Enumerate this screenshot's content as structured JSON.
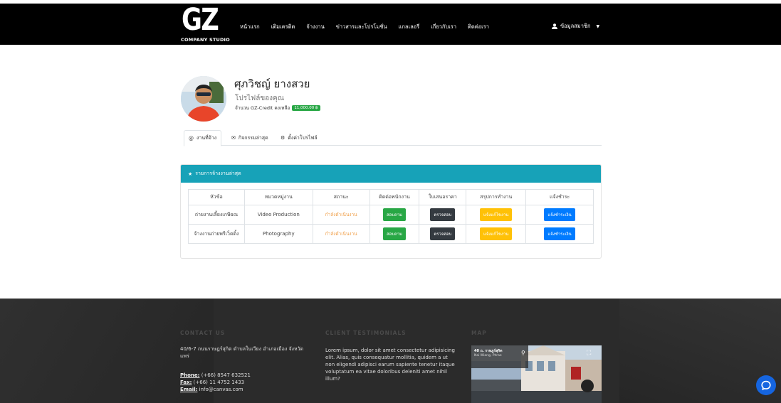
{
  "header": {
    "logo_text": "GZ",
    "logo_sub": "COMPANY STUDIO",
    "nav": [
      "หน้าแรก",
      "เติมเครดิต",
      "จ้างงาน",
      "ข่าวสารและโปรโมชั่น",
      "แกลเลอรี่",
      "เกี่ยวกับเรา",
      "ติดต่อเรา"
    ],
    "member_label": "ข้อมูลสมาชิก"
  },
  "profile": {
    "name": "ศุภวิชญ์ ยางสวย",
    "subtitle": "โปรไฟล์ของคุณ",
    "credit_label": "จำนวน GZ-Credit คงเหลือ",
    "credit_value": "11,000.00 ฿"
  },
  "tabs": [
    {
      "label": "งานที่จ้าง",
      "icon": "at-icon"
    },
    {
      "label": "กิจกรรมล่าสุด",
      "icon": "envelope-icon"
    },
    {
      "label": "ตั้งค่าโปรไฟล์",
      "icon": "gears-icon"
    }
  ],
  "card": {
    "title": "รายการจ้างงานล่าสุด",
    "columns": [
      "หัวข้อ",
      "หมวดหมู่งาน",
      "สถานะ",
      "ติดต่อพนักงาน",
      "ใบเสนอราคา",
      "สรุปการทำงาน",
      "แจ้งชำระ"
    ],
    "rows": [
      {
        "topic": "ถ่ายงานเลี้ยงเกษียณ",
        "category": "Video Production",
        "status": "กำลังดำเนินงาน",
        "contact": "สอบถาม",
        "quote": "ตรวจสอบ",
        "summary": "แจ้งแก้ไขงาน",
        "pay": "แจ้งชำระเงิน"
      },
      {
        "topic": "จ้างงานถ่ายพรีเว็ดดิ้ง",
        "category": "Photography",
        "status": "กำลังดำเนินงาน",
        "contact": "สอบถาม",
        "quote": "ตรวจสอบ",
        "summary": "แจ้งแก้ไขงาน",
        "pay": "แจ้งชำระเงิน"
      }
    ]
  },
  "footer": {
    "contact_heading": "CONTACT US",
    "address": "40/6-7 ถนนราษฎร์สุกิต ตำบลในเวียง อำเภอเมือง จังหวัดแพร่",
    "phone_label": "Phone:",
    "phone": "(+66) 8547 632521",
    "fax_label": "Fax:",
    "fax": "(+66) 11 4752 1433",
    "email_label": "Email:",
    "email": "info@canvas.com",
    "testimonials_heading": "CLIENT TESTIMONIALS",
    "testimonial": "Lorem ipsum, dolor sit amet consectetur adipisicing elit. Alias, quis consequatur mollitia, quidem a ut non eligendi adipisci earum sapiente tenetur itaque voluptatum ea vitae doloribus deleniti amet nihil illum?",
    "map_heading": "MAP",
    "map_title": "40 ถ. ราษฎร์สุกิต",
    "map_sub": "Nai Wiang, Phrae"
  },
  "colors": {
    "header_bg": "#000000",
    "card_header": "#17a2b8",
    "footer_bg": "#2b2b2b",
    "status": "#f0a04b",
    "green": "#28a745",
    "dark": "#343a40",
    "yellow": "#ffc107",
    "blue": "#007bff",
    "chat": "#1565e0"
  }
}
